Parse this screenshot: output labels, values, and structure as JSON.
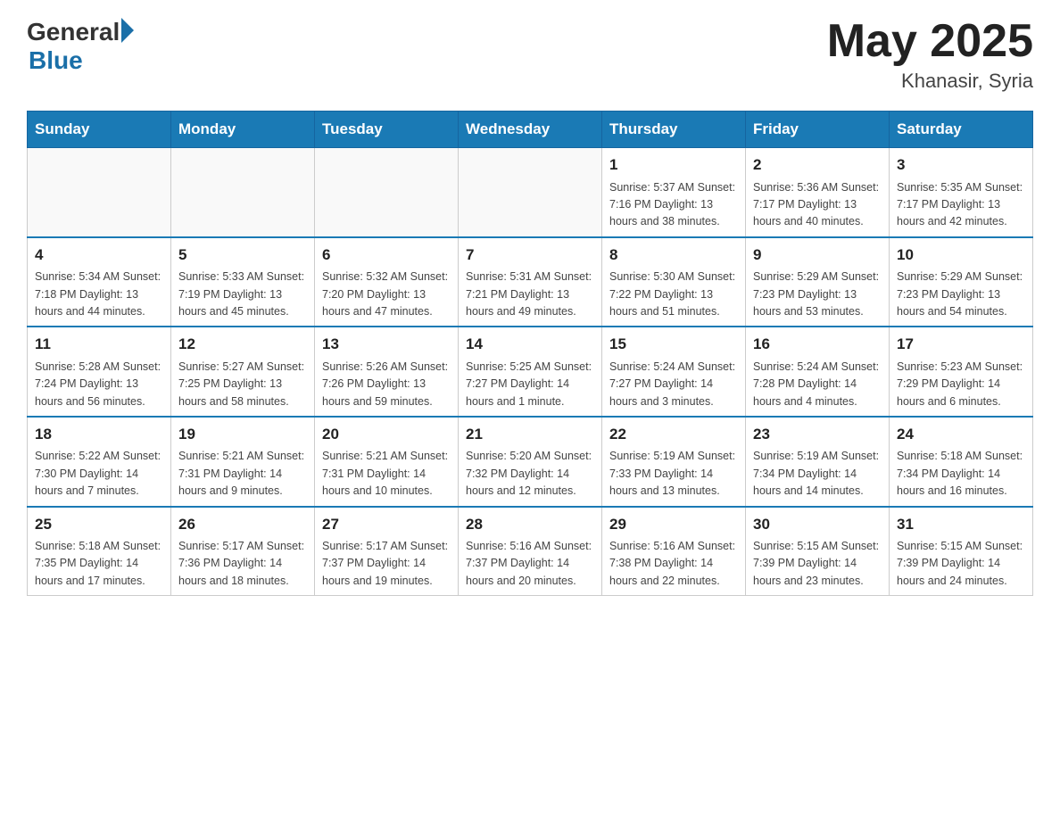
{
  "header": {
    "logo_general": "General",
    "logo_blue": "Blue",
    "month_year": "May 2025",
    "location": "Khanasir, Syria"
  },
  "weekdays": [
    "Sunday",
    "Monday",
    "Tuesday",
    "Wednesday",
    "Thursday",
    "Friday",
    "Saturday"
  ],
  "weeks": [
    [
      {
        "day": "",
        "info": ""
      },
      {
        "day": "",
        "info": ""
      },
      {
        "day": "",
        "info": ""
      },
      {
        "day": "",
        "info": ""
      },
      {
        "day": "1",
        "info": "Sunrise: 5:37 AM\nSunset: 7:16 PM\nDaylight: 13 hours\nand 38 minutes."
      },
      {
        "day": "2",
        "info": "Sunrise: 5:36 AM\nSunset: 7:17 PM\nDaylight: 13 hours\nand 40 minutes."
      },
      {
        "day": "3",
        "info": "Sunrise: 5:35 AM\nSunset: 7:17 PM\nDaylight: 13 hours\nand 42 minutes."
      }
    ],
    [
      {
        "day": "4",
        "info": "Sunrise: 5:34 AM\nSunset: 7:18 PM\nDaylight: 13 hours\nand 44 minutes."
      },
      {
        "day": "5",
        "info": "Sunrise: 5:33 AM\nSunset: 7:19 PM\nDaylight: 13 hours\nand 45 minutes."
      },
      {
        "day": "6",
        "info": "Sunrise: 5:32 AM\nSunset: 7:20 PM\nDaylight: 13 hours\nand 47 minutes."
      },
      {
        "day": "7",
        "info": "Sunrise: 5:31 AM\nSunset: 7:21 PM\nDaylight: 13 hours\nand 49 minutes."
      },
      {
        "day": "8",
        "info": "Sunrise: 5:30 AM\nSunset: 7:22 PM\nDaylight: 13 hours\nand 51 minutes."
      },
      {
        "day": "9",
        "info": "Sunrise: 5:29 AM\nSunset: 7:23 PM\nDaylight: 13 hours\nand 53 minutes."
      },
      {
        "day": "10",
        "info": "Sunrise: 5:29 AM\nSunset: 7:23 PM\nDaylight: 13 hours\nand 54 minutes."
      }
    ],
    [
      {
        "day": "11",
        "info": "Sunrise: 5:28 AM\nSunset: 7:24 PM\nDaylight: 13 hours\nand 56 minutes."
      },
      {
        "day": "12",
        "info": "Sunrise: 5:27 AM\nSunset: 7:25 PM\nDaylight: 13 hours\nand 58 minutes."
      },
      {
        "day": "13",
        "info": "Sunrise: 5:26 AM\nSunset: 7:26 PM\nDaylight: 13 hours\nand 59 minutes."
      },
      {
        "day": "14",
        "info": "Sunrise: 5:25 AM\nSunset: 7:27 PM\nDaylight: 14 hours\nand 1 minute."
      },
      {
        "day": "15",
        "info": "Sunrise: 5:24 AM\nSunset: 7:27 PM\nDaylight: 14 hours\nand 3 minutes."
      },
      {
        "day": "16",
        "info": "Sunrise: 5:24 AM\nSunset: 7:28 PM\nDaylight: 14 hours\nand 4 minutes."
      },
      {
        "day": "17",
        "info": "Sunrise: 5:23 AM\nSunset: 7:29 PM\nDaylight: 14 hours\nand 6 minutes."
      }
    ],
    [
      {
        "day": "18",
        "info": "Sunrise: 5:22 AM\nSunset: 7:30 PM\nDaylight: 14 hours\nand 7 minutes."
      },
      {
        "day": "19",
        "info": "Sunrise: 5:21 AM\nSunset: 7:31 PM\nDaylight: 14 hours\nand 9 minutes."
      },
      {
        "day": "20",
        "info": "Sunrise: 5:21 AM\nSunset: 7:31 PM\nDaylight: 14 hours\nand 10 minutes."
      },
      {
        "day": "21",
        "info": "Sunrise: 5:20 AM\nSunset: 7:32 PM\nDaylight: 14 hours\nand 12 minutes."
      },
      {
        "day": "22",
        "info": "Sunrise: 5:19 AM\nSunset: 7:33 PM\nDaylight: 14 hours\nand 13 minutes."
      },
      {
        "day": "23",
        "info": "Sunrise: 5:19 AM\nSunset: 7:34 PM\nDaylight: 14 hours\nand 14 minutes."
      },
      {
        "day": "24",
        "info": "Sunrise: 5:18 AM\nSunset: 7:34 PM\nDaylight: 14 hours\nand 16 minutes."
      }
    ],
    [
      {
        "day": "25",
        "info": "Sunrise: 5:18 AM\nSunset: 7:35 PM\nDaylight: 14 hours\nand 17 minutes."
      },
      {
        "day": "26",
        "info": "Sunrise: 5:17 AM\nSunset: 7:36 PM\nDaylight: 14 hours\nand 18 minutes."
      },
      {
        "day": "27",
        "info": "Sunrise: 5:17 AM\nSunset: 7:37 PM\nDaylight: 14 hours\nand 19 minutes."
      },
      {
        "day": "28",
        "info": "Sunrise: 5:16 AM\nSunset: 7:37 PM\nDaylight: 14 hours\nand 20 minutes."
      },
      {
        "day": "29",
        "info": "Sunrise: 5:16 AM\nSunset: 7:38 PM\nDaylight: 14 hours\nand 22 minutes."
      },
      {
        "day": "30",
        "info": "Sunrise: 5:15 AM\nSunset: 7:39 PM\nDaylight: 14 hours\nand 23 minutes."
      },
      {
        "day": "31",
        "info": "Sunrise: 5:15 AM\nSunset: 7:39 PM\nDaylight: 14 hours\nand 24 minutes."
      }
    ]
  ]
}
